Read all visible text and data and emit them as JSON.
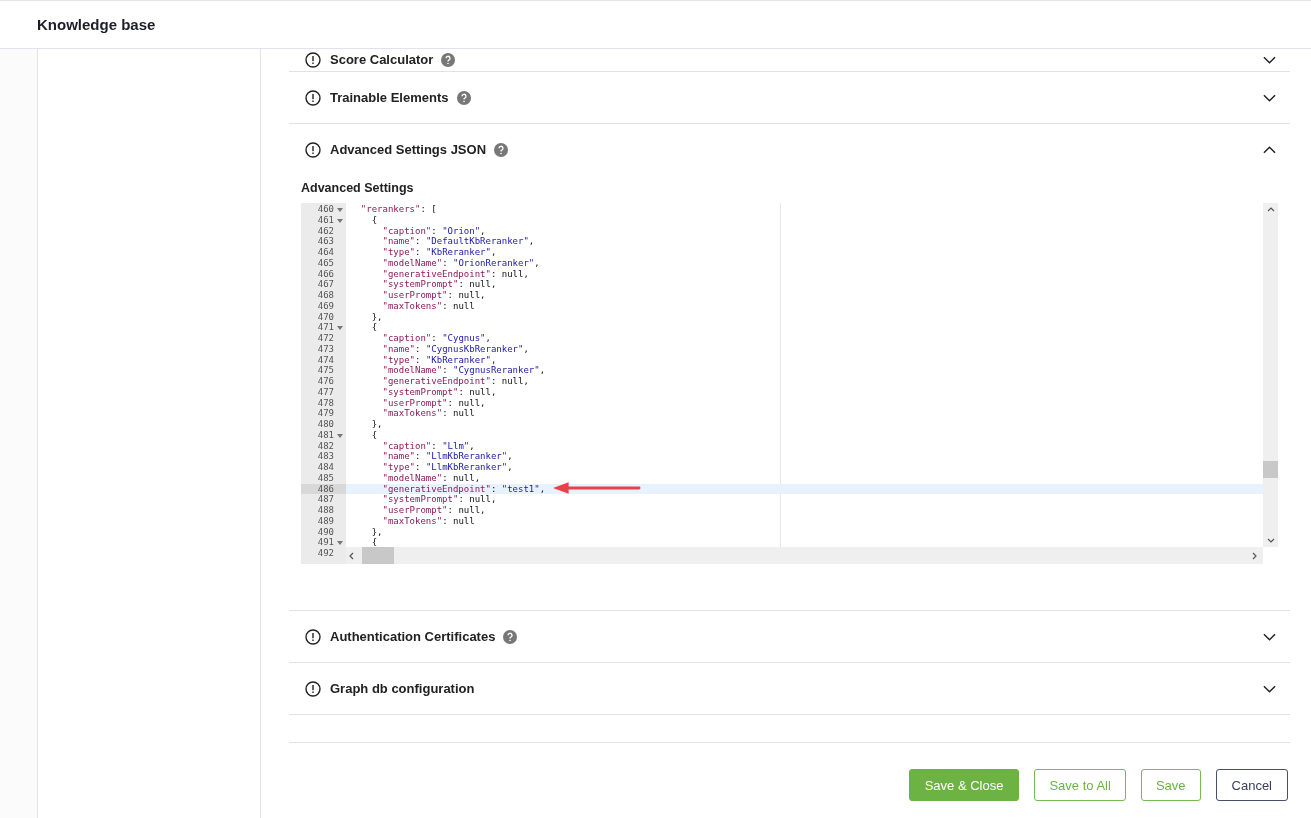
{
  "header": {
    "title": "Knowledge base"
  },
  "sections_before": [
    {
      "title": "Score Calculator",
      "help": true,
      "expanded": false,
      "clipped": true
    },
    {
      "title": "Trainable Elements",
      "help": true,
      "expanded": false,
      "clipped": false
    }
  ],
  "advanced": {
    "title": "Advanced Settings JSON",
    "help": true,
    "expanded": true,
    "field_label": "Advanced Settings",
    "editor": {
      "lines": [
        {
          "number": "460",
          "fold": true,
          "active": false,
          "text": "  \"rerankers\": ["
        },
        {
          "number": "461",
          "fold": true,
          "active": false,
          "text": "    {"
        },
        {
          "number": "462",
          "fold": false,
          "active": false,
          "text": "      \"caption\": \"Orion\","
        },
        {
          "number": "463",
          "fold": false,
          "active": false,
          "text": "      \"name\": \"DefaultKbReranker\","
        },
        {
          "number": "464",
          "fold": false,
          "active": false,
          "text": "      \"type\": \"KbReranker\","
        },
        {
          "number": "465",
          "fold": false,
          "active": false,
          "text": "      \"modelName\": \"OrionReranker\","
        },
        {
          "number": "466",
          "fold": false,
          "active": false,
          "text": "      \"generativeEndpoint\": null,"
        },
        {
          "number": "467",
          "fold": false,
          "active": false,
          "text": "      \"systemPrompt\": null,"
        },
        {
          "number": "468",
          "fold": false,
          "active": false,
          "text": "      \"userPrompt\": null,"
        },
        {
          "number": "469",
          "fold": false,
          "active": false,
          "text": "      \"maxTokens\": null"
        },
        {
          "number": "470",
          "fold": false,
          "active": false,
          "text": "    },"
        },
        {
          "number": "471",
          "fold": true,
          "active": false,
          "text": "    {"
        },
        {
          "number": "472",
          "fold": false,
          "active": false,
          "text": "      \"caption\": \"Cygnus\","
        },
        {
          "number": "473",
          "fold": false,
          "active": false,
          "text": "      \"name\": \"CygnusKbReranker\","
        },
        {
          "number": "474",
          "fold": false,
          "active": false,
          "text": "      \"type\": \"KbReranker\","
        },
        {
          "number": "475",
          "fold": false,
          "active": false,
          "text": "      \"modelName\": \"CygnusReranker\","
        },
        {
          "number": "476",
          "fold": false,
          "active": false,
          "text": "      \"generativeEndpoint\": null,"
        },
        {
          "number": "477",
          "fold": false,
          "active": false,
          "text": "      \"systemPrompt\": null,"
        },
        {
          "number": "478",
          "fold": false,
          "active": false,
          "text": "      \"userPrompt\": null,"
        },
        {
          "number": "479",
          "fold": false,
          "active": false,
          "text": "      \"maxTokens\": null"
        },
        {
          "number": "480",
          "fold": false,
          "active": false,
          "text": "    },"
        },
        {
          "number": "481",
          "fold": true,
          "active": false,
          "text": "    {"
        },
        {
          "number": "482",
          "fold": false,
          "active": false,
          "text": "      \"caption\": \"Llm\","
        },
        {
          "number": "483",
          "fold": false,
          "active": false,
          "text": "      \"name\": \"LlmKbReranker\","
        },
        {
          "number": "484",
          "fold": false,
          "active": false,
          "text": "      \"type\": \"LlmKbReranker\","
        },
        {
          "number": "485",
          "fold": false,
          "active": false,
          "text": "      \"modelName\": null,"
        },
        {
          "number": "486",
          "fold": false,
          "active": true,
          "text": "      \"generativeEndpoint\": \"test1\","
        },
        {
          "number": "487",
          "fold": false,
          "active": false,
          "text": "      \"systemPrompt\": null,"
        },
        {
          "number": "488",
          "fold": false,
          "active": false,
          "text": "      \"userPrompt\": null,"
        },
        {
          "number": "489",
          "fold": false,
          "active": false,
          "text": "      \"maxTokens\": null"
        },
        {
          "number": "490",
          "fold": false,
          "active": false,
          "text": "    },"
        },
        {
          "number": "491",
          "fold": true,
          "active": false,
          "text": "    {"
        },
        {
          "number": "492",
          "fold": false,
          "active": false
        }
      ]
    }
  },
  "sections_after": [
    {
      "title": "Authentication Certificates",
      "help": true,
      "expanded": false
    },
    {
      "title": "Graph db configuration",
      "help": false,
      "expanded": false
    }
  ],
  "buttons": [
    {
      "label": "Save & Close",
      "kind": "primary"
    },
    {
      "label": "Save to All",
      "kind": "outline"
    },
    {
      "label": "Save",
      "kind": "outline"
    },
    {
      "label": "Cancel",
      "kind": "secondary"
    }
  ]
}
